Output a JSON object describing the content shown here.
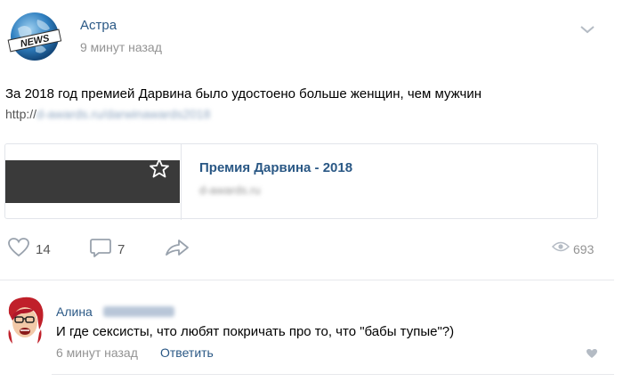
{
  "post": {
    "author": "Астра",
    "time": "9 минут назад",
    "avatar_badge": "NEWS",
    "text": "За 2018 год премией Дарвина было удостоено больше женщин, чем мужчин",
    "link_prefix": "http://",
    "link_blurred": "d-awards.ru/darwinawards2018",
    "card": {
      "title": "Премия Дарвина - 2018",
      "domain_blurred": "d-awards.ru"
    },
    "actions": {
      "likes": "14",
      "comments": "7",
      "views": "693"
    }
  },
  "comment": {
    "author": "Алина",
    "text": "И где сексисты, что любят покричать про то, что \"бабы тупые\"?)",
    "time": "6 минут назад",
    "reply_label": "Ответить"
  },
  "icons": {
    "like": "heart-icon",
    "comment": "comment-icon",
    "share": "share-icon",
    "views": "eye-icon",
    "menu": "chevron-down-icon",
    "bookmark": "star-icon"
  },
  "colors": {
    "link_blue": "#2a5885",
    "muted_gray": "#939393",
    "icon_gray": "#99a2ad"
  }
}
